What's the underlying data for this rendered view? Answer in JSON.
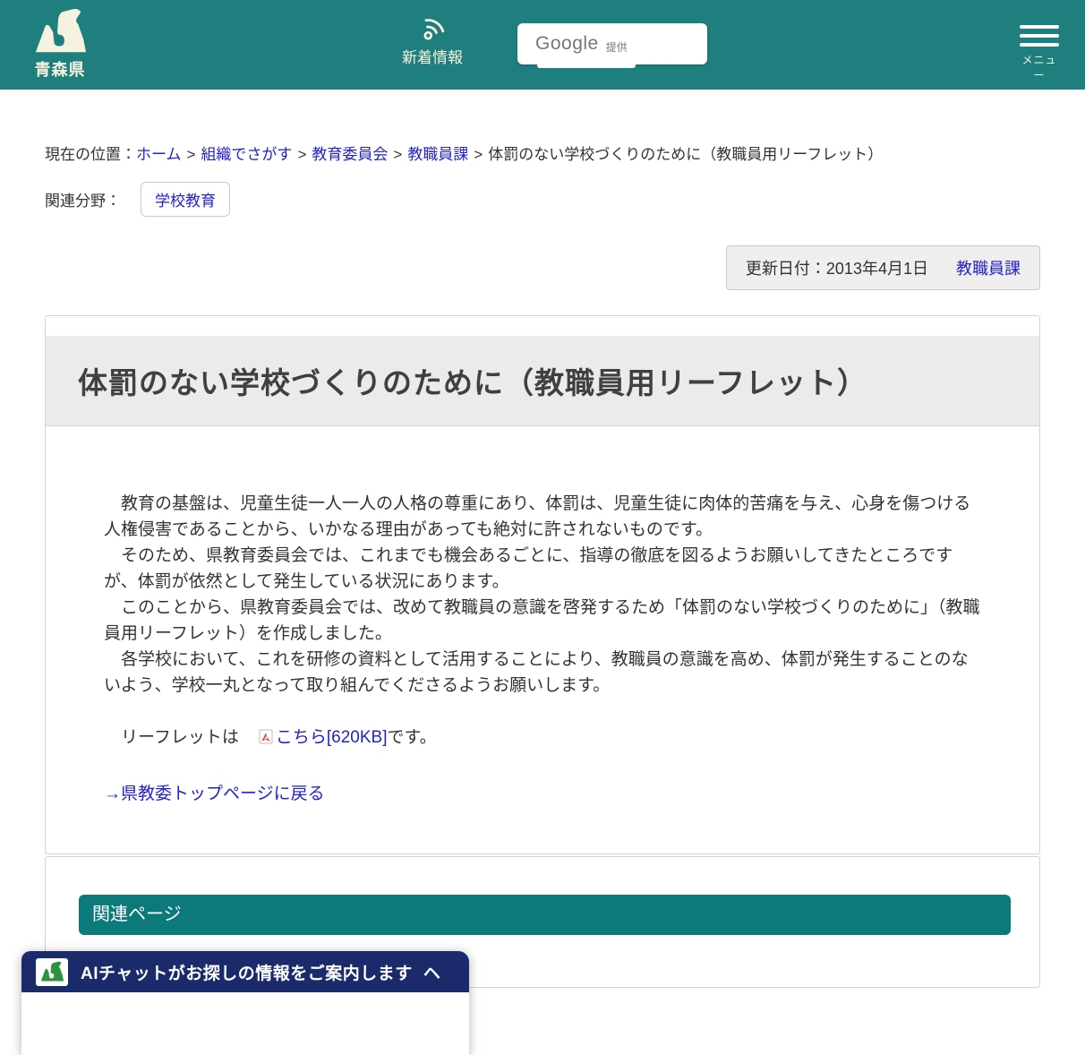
{
  "header": {
    "logo_text": "青森県",
    "news_label": "新着情報",
    "search": {
      "brand": "Google",
      "provided": "提供"
    },
    "menu_label": "メニュー"
  },
  "breadcrumb": {
    "prefix": "現在の位置：",
    "separator": ">",
    "links": [
      "ホーム",
      "組織でさがす",
      "教育委員会",
      "教職員課"
    ],
    "current": "体罰のない学校づくりのために（教職員用リーフレット）"
  },
  "related_field": {
    "label": "関連分野：",
    "tag": "学校教育"
  },
  "meta": {
    "updated": "更新日付：2013年4月1日",
    "department": "教職員課"
  },
  "article": {
    "title": "体罰のない学校づくりのために（教職員用リーフレット）",
    "paragraphs": [
      "教育の基盤は、児童生徒一人一人の人格の尊重にあり、体罰は、児童生徒に肉体的苦痛を与え、心身を傷つける人権侵害であることから、いかなる理由があっても絶対に許されないものです。",
      "そのため、県教育委員会では、これまでも機会あるごとに、指導の徹底を図るようお願いしてきたところですが、体罰が依然として発生している状況にあります。",
      "このことから、県教育委員会では、改めて教職員の意識を啓発するため「体罰のない学校づくりのために」（教職員用リーフレット）を作成しました。",
      "各学校において、これを研修の資料として活用することにより、教職員の意識を高め、体罰が発生することのないよう、学校一丸となって取り組んでくださるようお願いします。"
    ],
    "leaflet": {
      "before": "リーフレットは",
      "link": "こちら[620KB]",
      "after": "です。"
    },
    "back_link": "→県教委トップページに戻る"
  },
  "related_pages": {
    "heading": "関連ページ"
  },
  "chat": {
    "label": "AIチャットがお探しの情報をご案内します",
    "chevron": "ヘ"
  },
  "colors": {
    "header_teal": "#1f7e7e",
    "bar_teal": "#0c7a7a",
    "chat_navy": "#1a2a6b",
    "cream": "#f5f2df",
    "link_blue": "#2222cc",
    "logo_green": "#2e9141"
  }
}
